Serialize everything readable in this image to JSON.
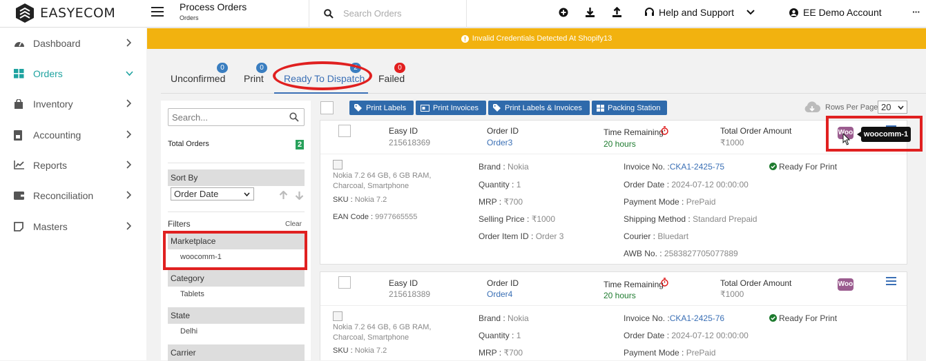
{
  "brand": "EASYECOM",
  "header": {
    "title": "Process Orders",
    "subtitle": "Orders",
    "search_placeholder": "Search Orders",
    "help": "Help and Support",
    "account": "EE Demo Account",
    "more": "···"
  },
  "sidebar": {
    "items": [
      {
        "label": "Dashboard",
        "icon": "dashboard-icon"
      },
      {
        "label": "Orders",
        "icon": "grid-icon"
      },
      {
        "label": "Inventory",
        "icon": "bag-icon"
      },
      {
        "label": "Accounting",
        "icon": "ledger-icon"
      },
      {
        "label": "Reports",
        "icon": "chart-icon"
      },
      {
        "label": "Reconciliation",
        "icon": "wallet-icon"
      },
      {
        "label": "Masters",
        "icon": "note-icon"
      }
    ]
  },
  "alert": "Invalid Credentials Detected At Shopify13",
  "tabs": [
    {
      "label": "Unconfirmed",
      "count": "0"
    },
    {
      "label": "Print",
      "count": "0"
    },
    {
      "label": "Ready To Dispatch",
      "count": "2"
    },
    {
      "label": "Failed",
      "count": "0"
    }
  ],
  "filters": {
    "search_placeholder": "Search...",
    "total_label": "Total Orders",
    "total": "2",
    "sort_by": "Sort By",
    "sort_value": "Order Date",
    "filters_label": "Filters",
    "clear": "Clear",
    "groups": [
      {
        "title": "Marketplace",
        "value": "woocomm-1"
      },
      {
        "title": "Category",
        "value": "Tablets"
      },
      {
        "title": "State",
        "value": "Delhi"
      },
      {
        "title": "Carrier",
        "value": ""
      }
    ]
  },
  "actions": {
    "print_labels": "Print Labels",
    "print_invoices": "Print Invoices",
    "print_both": "Print Labels & Invoices",
    "packing": "Packing Station",
    "rows_label": "Rows Per Page",
    "rows": "20"
  },
  "tooltip": "woocomm-1",
  "labels": {
    "easy_id": "Easy ID",
    "order_id": "Order ID",
    "time_remaining": "Time Remaining",
    "total_amount": "Total Order Amount",
    "brand": "Brand : ",
    "quantity": "Quantity : ",
    "mrp": "MRP : ",
    "selling": "Selling Price : ",
    "item_id": "Order Item ID : ",
    "invoice": "Invoice No. :",
    "order_date": "Order Date : ",
    "payment": "Payment Mode : ",
    "shipping": "Shipping Method : ",
    "courier": "Courier : ",
    "awb": "AWB No. : ",
    "sku": "SKU : ",
    "ean": "EAN Code : "
  },
  "orders": [
    {
      "easy_id": "215618369",
      "order_id": "Order3",
      "time": "20 hours",
      "amount": "₹1000",
      "product": "Nokia 7.2 64 GB, 6 GB RAM, Charcoal, Smartphone",
      "sku": "Nokia 7.2",
      "ean": "9977665555",
      "brand": "Nokia",
      "qty": "1",
      "mrp": "₹700",
      "selling": "₹1000",
      "item_id": "Order 3",
      "invoice": "CKA1-2425-75",
      "status": "Ready For Print",
      "order_date": "2024-07-12 00:00:00",
      "payment": "PrePaid",
      "shipping": "Standard Prepaid",
      "courier": "Bluedart",
      "awb": "2583827705077889",
      "marketplace": "Woo"
    },
    {
      "easy_id": "215618389",
      "order_id": "Order4",
      "time": "20 hours",
      "amount": "₹1000",
      "product": "Nokia 7.2 64 GB, 6 GB RAM, Charcoal, Smartphone",
      "sku": "Nokia 7.2",
      "brand": "Nokia",
      "qty": "1",
      "mrp": "₹700",
      "invoice": "CKA1-2425-76",
      "status": "Ready For Print",
      "order_date": "2024-07-12 00:00:00",
      "payment": "PrePaid",
      "marketplace": "Woo"
    }
  ],
  "colors": {
    "accent": "#1fa3a0",
    "alert": "#f2b20f",
    "primary": "#2f6aab",
    "highlight": "#e02020"
  }
}
